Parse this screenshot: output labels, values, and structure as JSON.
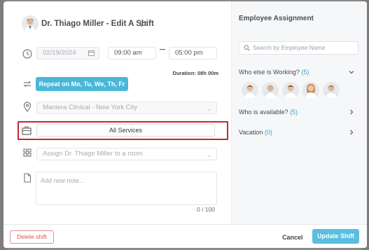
{
  "header": {
    "title": "Dr. Thiago Miller - Edit A Shift"
  },
  "schedule": {
    "date": "02/19/2024",
    "start_time": "09:00 am",
    "end_time": "05:00 pm",
    "duration": "Duration: 08h 00m"
  },
  "repeat": {
    "label": "Repeat on Mo, Tu, We, Th, Fr"
  },
  "location": {
    "value": "Maniera Clinical - New York City"
  },
  "services": {
    "value": "All Services"
  },
  "room": {
    "placeholder": "Assign Dr. Thiago Miller to a room"
  },
  "note": {
    "placeholder": "Add new note...",
    "counter": "0 / 100"
  },
  "assignment": {
    "title": "Employee Assignment",
    "search_placeholder": "Search by Employee Name",
    "sections": [
      {
        "label": "Who else is Working?",
        "count": "(5)"
      },
      {
        "label": "Who is available?",
        "count": "(5)"
      },
      {
        "label": "Vacation",
        "count": "(0)"
      }
    ]
  },
  "footer": {
    "delete_label": "Delete shift",
    "cancel_label": "Cancel",
    "update_label": "Update Shift"
  },
  "colors": {
    "accent": "#4bb7d8",
    "danger": "#c8282e",
    "count": "#3aa0cc"
  }
}
